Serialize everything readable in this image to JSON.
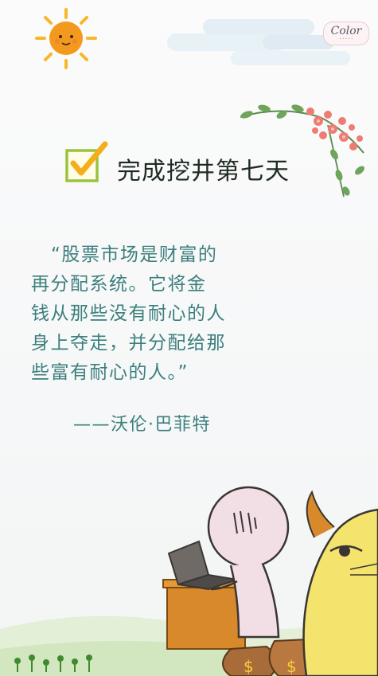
{
  "brand": {
    "logo": "Color",
    "tagline": "• • • • •"
  },
  "title": "完成挖井第七天",
  "quote": {
    "lines": [
      "“股票市场是财富的",
      "再分配系统。它将金",
      "钱从那些没有耐心的人",
      "身上夺走，并分配给那",
      "些富有耐心的人。”"
    ],
    "author": "——沃伦·巴菲特"
  },
  "icons": [
    "sun-icon",
    "checkbox-checked-icon",
    "flower-branch-icon",
    "laptop-icon",
    "money-bag-icon"
  ],
  "colors": {
    "quote": "#3c7f7d",
    "check": "#9ac33c",
    "sun": "#f4a21d",
    "background": "#f6f7f8"
  }
}
